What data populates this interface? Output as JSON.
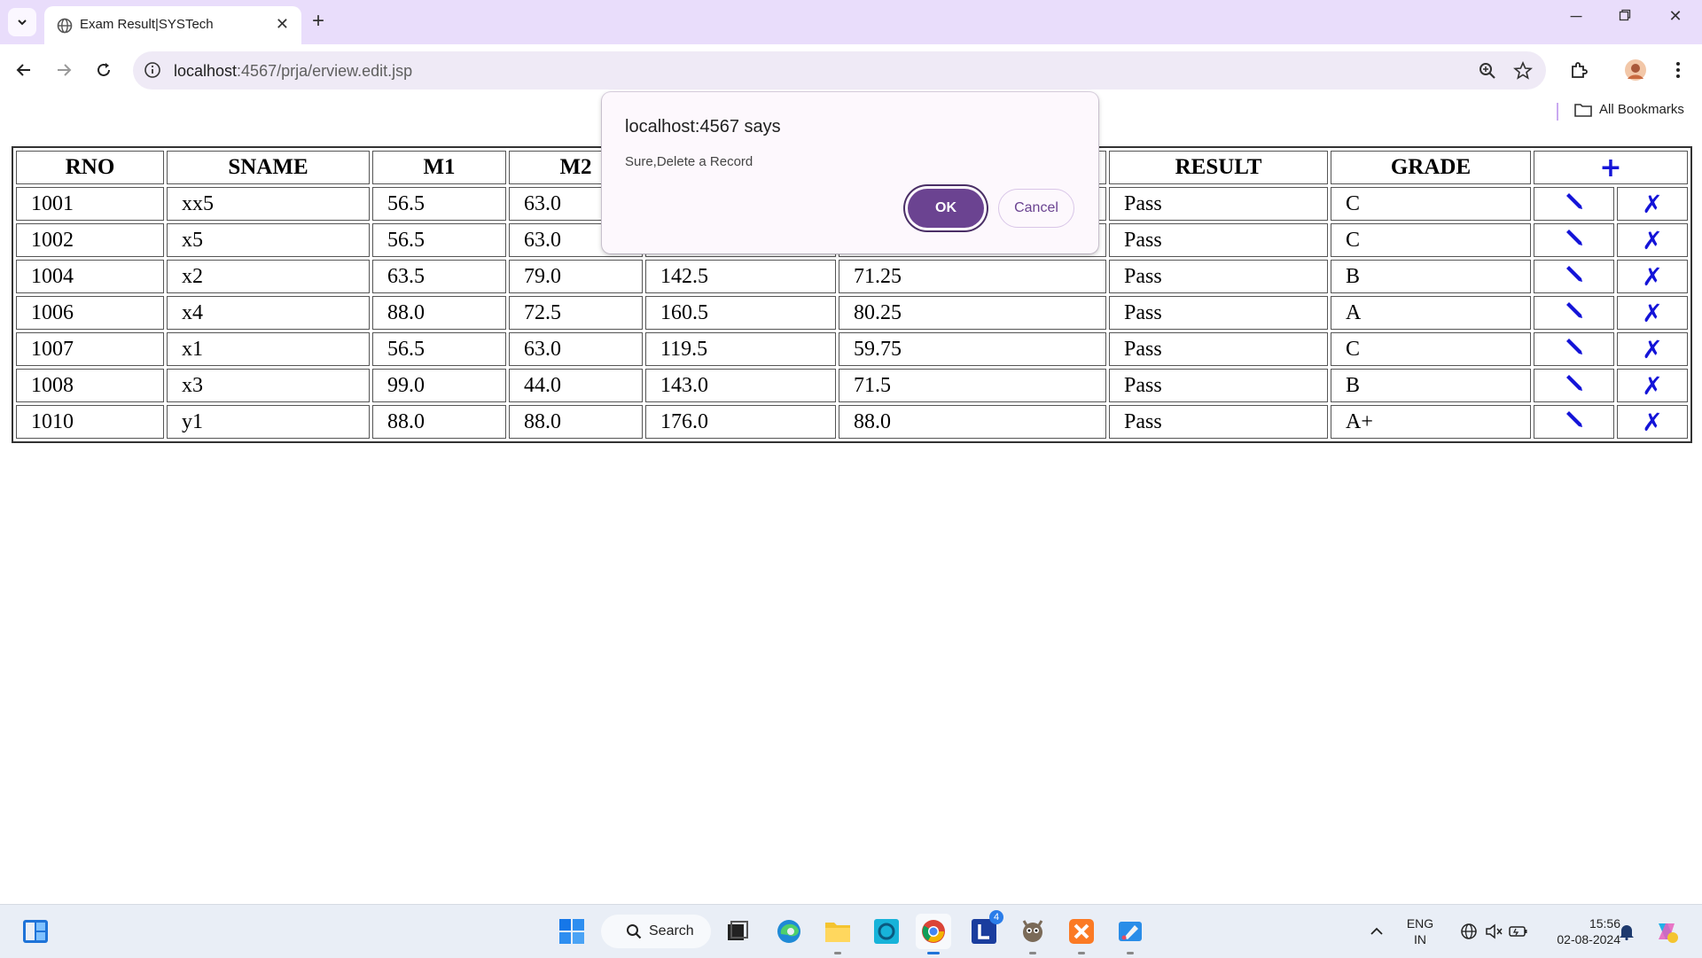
{
  "browser": {
    "tab_title": "Exam Result|SYSTech",
    "url_host": "localhost",
    "url_rest": ":4567/prja/erview.edit.jsp",
    "bookmarks_label": "All Bookmarks"
  },
  "table": {
    "headers": [
      "RNO",
      "SNAME",
      "M1",
      "M2",
      "",
      "",
      "RESULT",
      "GRADE"
    ],
    "add_icon": "plus-icon",
    "rows": [
      {
        "rno": "1001",
        "sname": "xx5",
        "m1": "56.5",
        "m2": "63.0",
        "total": "",
        "avg": "",
        "result": "Pass",
        "grade": "C"
      },
      {
        "rno": "1002",
        "sname": "x5",
        "m1": "56.5",
        "m2": "63.0",
        "total": "",
        "avg": "",
        "result": "Pass",
        "grade": "C"
      },
      {
        "rno": "1004",
        "sname": "x2",
        "m1": "63.5",
        "m2": "79.0",
        "total": "142.5",
        "avg": "71.25",
        "result": "Pass",
        "grade": "B"
      },
      {
        "rno": "1006",
        "sname": "x4",
        "m1": "88.0",
        "m2": "72.5",
        "total": "160.5",
        "avg": "80.25",
        "result": "Pass",
        "grade": "A"
      },
      {
        "rno": "1007",
        "sname": "x1",
        "m1": "56.5",
        "m2": "63.0",
        "total": "119.5",
        "avg": "59.75",
        "result": "Pass",
        "grade": "C"
      },
      {
        "rno": "1008",
        "sname": "x3",
        "m1": "99.0",
        "m2": "44.0",
        "total": "143.0",
        "avg": "71.5",
        "result": "Pass",
        "grade": "B"
      },
      {
        "rno": "1010",
        "sname": "y1",
        "m1": "88.0",
        "m2": "88.0",
        "total": "176.0",
        "avg": "88.0",
        "result": "Pass",
        "grade": "A+"
      }
    ],
    "action_color": "#1414d8"
  },
  "dialog": {
    "title": "localhost:4567 says",
    "message": "Sure,Delete a Record",
    "ok_label": "OK",
    "cancel_label": "Cancel",
    "ok_color": "#6b4391"
  },
  "taskbar": {
    "search_label": "Search",
    "lang_top": "ENG",
    "lang_bottom": "IN",
    "time": "15:56",
    "date": "02-08-2024",
    "badge_count": "4"
  }
}
